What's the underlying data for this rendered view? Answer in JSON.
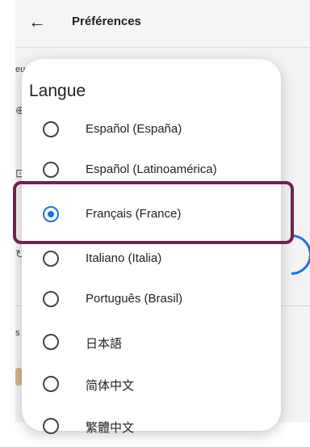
{
  "header": {
    "title": "Préférences",
    "back_icon": "←"
  },
  "background": {
    "side_text": "eu",
    "side_text2": "s"
  },
  "dialog": {
    "title": "Langue",
    "options": [
      {
        "label": "Español (España)",
        "selected": false
      },
      {
        "label": "Español (Latinoamérica)",
        "selected": false
      },
      {
        "label": "Français (France)",
        "selected": true
      },
      {
        "label": "Italiano (Italia)",
        "selected": false
      },
      {
        "label": "Português (Brasil)",
        "selected": false
      },
      {
        "label": "日本語",
        "selected": false
      },
      {
        "label": "简体中文",
        "selected": false
      },
      {
        "label": "繁體中文",
        "selected": false
      }
    ]
  },
  "colors": {
    "accent": "#1a73e8",
    "highlight": "#7a1f4f"
  }
}
